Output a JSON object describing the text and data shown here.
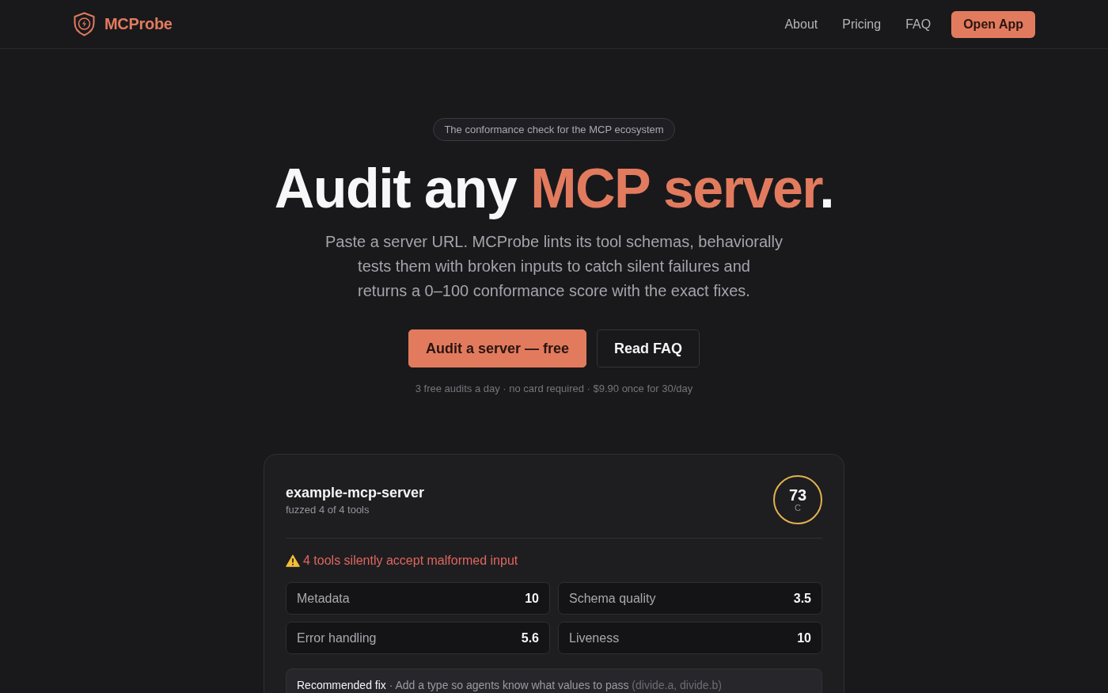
{
  "header": {
    "brand": "MCProbe",
    "nav": [
      "About",
      "Pricing",
      "FAQ"
    ],
    "cta": "Open App"
  },
  "hero": {
    "eyebrow": "The conformance check for the MCP ecosystem",
    "headline": {
      "lead": "Audit any",
      "highlight": "MCP server",
      "trail": "."
    },
    "description_lines": [
      "Paste a server URL. MCProbe lints its tool schemas, behaviorally",
      "tests them with broken inputs to catch silent failures and",
      "returns a 0–100 conformance score with the exact fixes."
    ],
    "buttons": [
      {
        "label": "Audit a server — free",
        "kind": "primary"
      },
      {
        "label": "Read FAQ",
        "kind": "outline"
      }
    ],
    "note": "3 free audits a day · no card required · $9.90 once for 30/day"
  },
  "report": {
    "server_name": "example-mcp-server",
    "subtitle": "fuzzed 4 of 4 tools",
    "score": "73",
    "grade": "C",
    "warning": "4 tools silently accept malformed input",
    "metrics": [
      {
        "label": "Metadata",
        "value": "10"
      },
      {
        "label": "Schema quality",
        "value": "3.5"
      },
      {
        "label": "Error handling",
        "value": "5.6"
      },
      {
        "label": "Liveness",
        "value": "10"
      }
    ],
    "recommended_fix": {
      "label": "Recommended fix",
      "text": "· Add a type so agents know what values to pass",
      "detail": "(divide.a, divide.b)"
    }
  }
}
